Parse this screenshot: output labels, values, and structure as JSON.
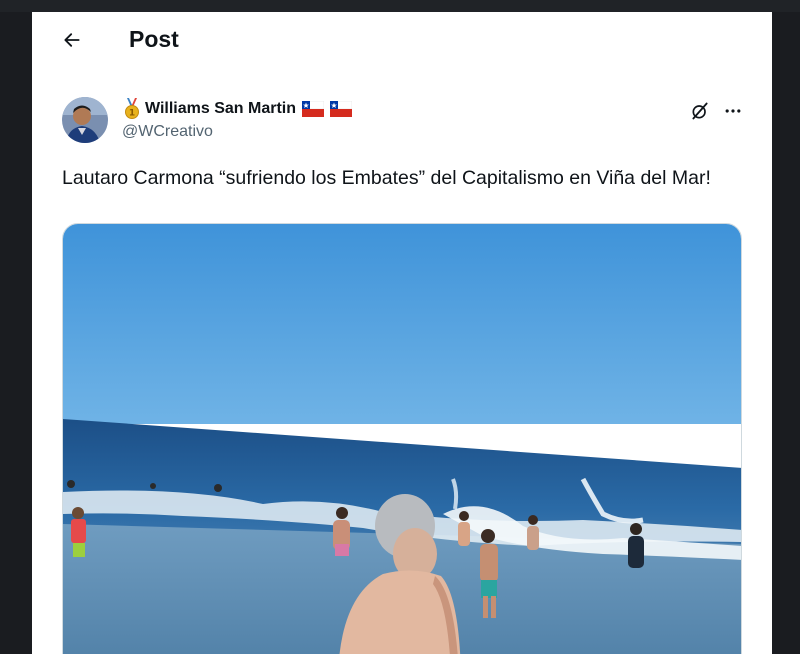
{
  "header": {
    "title": "Post",
    "back_icon": "arrow-left-icon"
  },
  "author": {
    "badge_icon": "medal-icon",
    "name": "Williams San Martin",
    "flags": [
      "chile-flag-icon",
      "chile-flag-icon"
    ],
    "handle": "@WCreativo"
  },
  "actions": {
    "grok_icon": "grok-icon",
    "more_icon": "more-horizontal-icon"
  },
  "tweet": {
    "text": "Lautaro Carmona “sufriendo los Embates” del Capitalismo en Viña del Mar!"
  },
  "colors": {
    "text": "#0f1419",
    "secondary": "#536471",
    "sky": "#4a9ad8",
    "sea": "#1f5e96"
  }
}
